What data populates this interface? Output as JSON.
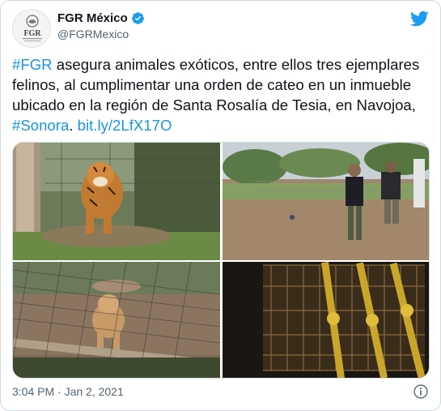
{
  "author": {
    "display_name": "FGR México",
    "handle": "@FGRMexico",
    "avatar_icon": "fgr-seal-logo",
    "avatar_text": "FGR",
    "verified_icon": "verified-badge-icon"
  },
  "brand_icon": "twitter-bird-icon",
  "tweet": {
    "hashtag_1": "#FGR",
    "text_1": " asegura animales exóticos, entre ellos tres ejemplares felinos, al cumplimentar una orden de cateo en un inmueble ubicado en la región de Santa Rosalía de Tesia, en Navojoa, ",
    "hashtag_2": "#Sonora",
    "text_2": ". ",
    "link": "bit.ly/2LfX17O"
  },
  "media": [
    {
      "subject": "tiger-in-enclosure"
    },
    {
      "subject": "agents-in-yard"
    },
    {
      "subject": "lion-cub-behind-fence"
    },
    {
      "subject": "cage-with-straps"
    }
  ],
  "timestamp": "3:04 PM · Jan 2, 2021",
  "colors": {
    "link": "#1b95e0",
    "verified": "#1d9bf0",
    "twitter": "#1d9bf0",
    "meta": "#536471"
  }
}
